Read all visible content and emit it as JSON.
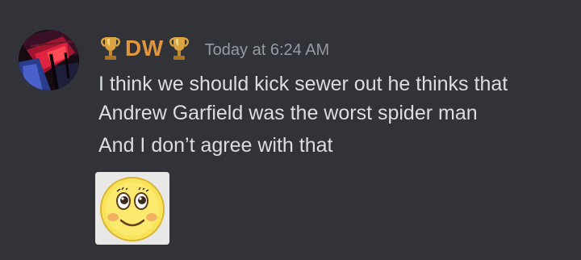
{
  "message": {
    "author": "DW",
    "badge_icon": "trophy-icon",
    "timestamp": "Today at 6:24 AM",
    "lines": [
      "I think we should kick sewer out he thinks that",
      "Andrew Garfield was the worst spider man",
      "And I don’t agree with that"
    ],
    "attachment": "smiley-emoji",
    "colors": {
      "background": "#313338",
      "username": "#e0953f",
      "timestamp": "#949ba4",
      "text": "#dbdee1"
    }
  }
}
